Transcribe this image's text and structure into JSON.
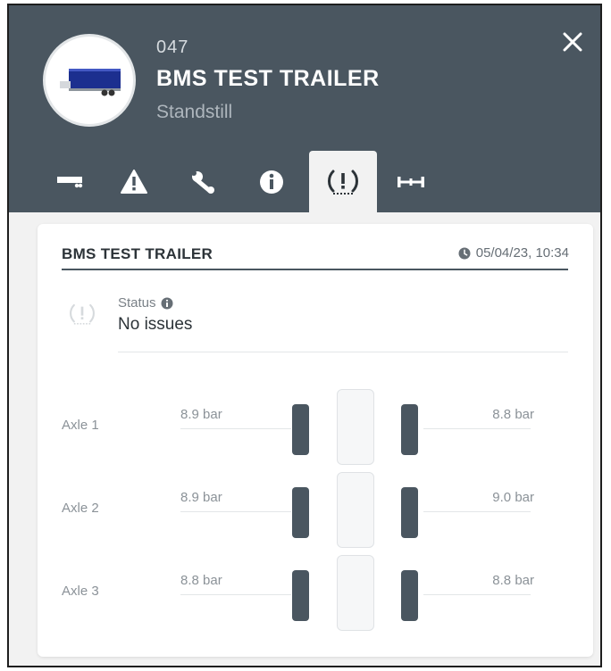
{
  "vehicle": {
    "id": "047",
    "name": "BMS TEST TRAILER",
    "state": "Standstill"
  },
  "header": {
    "close_icon": "close-icon"
  },
  "tabs": [
    {
      "icon": "trailer-icon",
      "active": false
    },
    {
      "icon": "warning-icon",
      "active": false
    },
    {
      "icon": "wrench-icon",
      "active": false
    },
    {
      "icon": "info-icon",
      "active": false
    },
    {
      "icon": "tyre-pressure-icon",
      "active": true
    },
    {
      "icon": "axle-icon",
      "active": false
    }
  ],
  "card": {
    "title": "BMS TEST TRAILER",
    "timestamp": "05/04/23, 10:34",
    "status_label": "Status",
    "status_value": "No issues"
  },
  "axles": [
    {
      "label": "Axle 1",
      "left_pressure": "8.9 bar",
      "right_pressure": "8.8 bar"
    },
    {
      "label": "Axle 2",
      "left_pressure": "8.9 bar",
      "right_pressure": "9.0 bar"
    },
    {
      "label": "Axle 3",
      "left_pressure": "8.8 bar",
      "right_pressure": "8.8 bar"
    }
  ],
  "colors": {
    "header_bg": "#4a5660",
    "tyre": "#4a5660",
    "panel_bg": "#f2f2f2",
    "trailer_blue": "#1c2f8f"
  }
}
